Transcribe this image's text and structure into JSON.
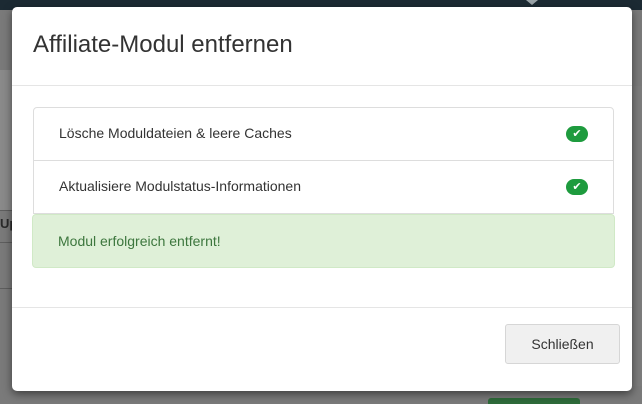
{
  "modal": {
    "title": "Affiliate-Modul entfernen",
    "steps": [
      {
        "label": "Lösche Moduldateien & leere Caches",
        "status": "done",
        "icon": "check-icon"
      },
      {
        "label": "Aktualisiere Modulstatus-Informationen",
        "status": "done",
        "icon": "check-icon"
      }
    ],
    "success_message": "Modul erfolgreich entfernt!",
    "close_label": "Schließen"
  },
  "background": {
    "partial_column_label": "Up"
  },
  "colors": {
    "success_badge": "#1e9b3e",
    "alert_bg": "#dff0d8",
    "alert_text": "#3c763d",
    "topbar": "#1c2a33"
  }
}
